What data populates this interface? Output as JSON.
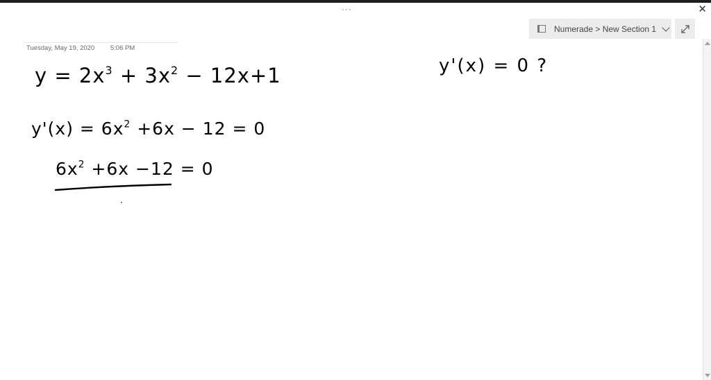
{
  "window": {
    "title_dots": "···",
    "close_glyph": "✕"
  },
  "section": {
    "breadcrumb": "Numerade > New Section 1"
  },
  "page": {
    "date": "Tuesday, May 19, 2020",
    "time": "5:06 PM"
  },
  "ink": {
    "eq1": {
      "lhs": "y = 2x",
      "e1": "3",
      "m1": " + 3x",
      "e2": "2",
      "rest": " − 12x+1"
    },
    "eq2": {
      "lhs": "y'(x) = 6x",
      "e1": "2",
      "rest": " +6x − 12   = 0"
    },
    "eq3": {
      "lhs": "6x",
      "e1": "2",
      "rest": " +6x −12 = 0"
    },
    "eq4": {
      "text": "y'(x) = 0  ?"
    }
  },
  "icons": {
    "notebook": "notebook-icon",
    "expand": "expand-icon",
    "chevron": "chevron-down-icon",
    "close": "close-icon"
  }
}
